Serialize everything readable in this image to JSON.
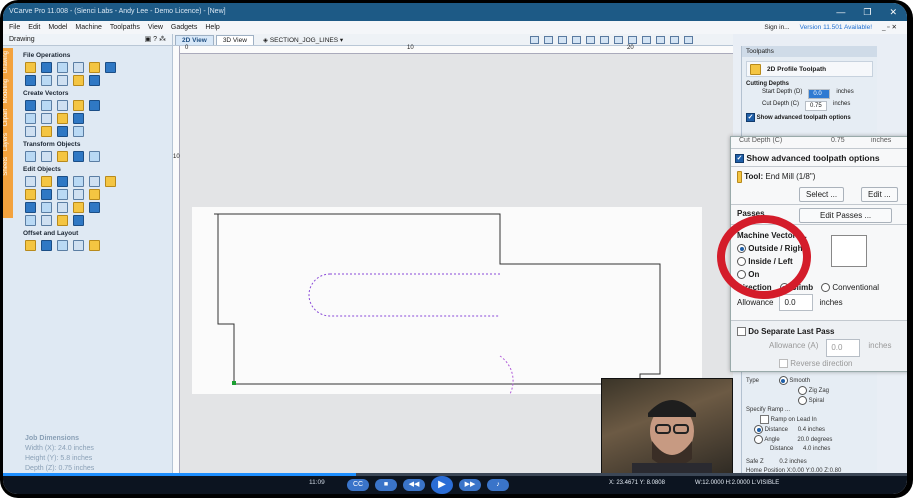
{
  "window": {
    "title": "VCarve Pro 11.008 - (Sienci Labs - Andy Lee - Demo Licence) - [New]"
  },
  "menu": [
    "File",
    "Edit",
    "Model",
    "Machine",
    "Toolpaths",
    "View",
    "Gadgets",
    "Help"
  ],
  "topright": {
    "signin": "Sign in...",
    "version": "Version 11.501 Available!"
  },
  "left_panel": {
    "header": "Drawing",
    "vtabs": [
      "Drawing",
      "Modeling",
      "Clipart",
      "Layers",
      "Sheets"
    ],
    "groups": [
      "File Operations",
      "Create Vectors",
      "Transform Objects",
      "Edit Objects",
      "Offset and Layout"
    ],
    "job": {
      "title": "Job Dimensions",
      "width": "Width  (X): 24.0 inches",
      "height": "Height (Y): 5.8 inches",
      "depth": "Depth  (Z): 0.75 inches"
    }
  },
  "view": {
    "tab_2d": "2D View",
    "tab_3d": "3D View",
    "layer": "SECTION_JOG_LINES",
    "ruler": [
      "0",
      "10",
      "20"
    ],
    "ruler_left": [
      "10"
    ]
  },
  "right_panel": {
    "header": "Toolpaths",
    "toolpath_title": "2D Profile Toolpath",
    "cutting_depths": "Cutting Depths",
    "start_depth_label": "Start Depth (D)",
    "start_depth": "0.0",
    "cut_depth_label": "Cut Depth (C)",
    "cut_depth": "0.75",
    "units": "inches",
    "adv": "Show advanced toolpath options",
    "lower": {
      "type": "Type",
      "smooth": "Smooth",
      "zigzag": "Zig Zag",
      "spiral": "Spiral",
      "ramp": "Specify Ramp ...",
      "ramp_lead": "Ramp on Lead In",
      "distance": "Distance",
      "dist_val": "0.4",
      "angle": "Angle",
      "angle_val": "20.0",
      "degrees": "degrees",
      "dist2": "Distance",
      "dist2_val": "4.0",
      "safe_z": "Safe Z",
      "safe_z_val": "0.2 inches",
      "home": "Home Position",
      "home_val": "X:0.00 Y:0.00 Z:0.80"
    }
  },
  "zoom_panel": {
    "adv": "Show advanced toolpath options",
    "cut_partial": "Cut Depth (C)",
    "cut_partial_val": "0.75",
    "tool_label": "Tool:",
    "tool_value": "End Mill (1/8\")",
    "select": "Select ...",
    "edit": "Edit ...",
    "passes": "Passes",
    "edit_passes": "Edit Passes ...",
    "machine_vectors": "Machine Vectors...",
    "outside": "Outside / Right",
    "inside": "Inside / Left",
    "on": "On",
    "direction": "Direction",
    "climb": "Climb",
    "conventional": "Conventional",
    "allowance_label": "Allowance",
    "allowance": "0.0",
    "inches": "inches",
    "separate": "Do Separate Last Pass",
    "allowance_a": "Allowance (A)",
    "allowance_a_val": "0.0",
    "reverse": "Reverse direction"
  },
  "player": {
    "time": "11:09",
    "progress": 0.39,
    "coords": "X: 23.4671 Y: 8.0808",
    "dims": "W:12.0000  H:2.0000  L:VISIBLE"
  }
}
